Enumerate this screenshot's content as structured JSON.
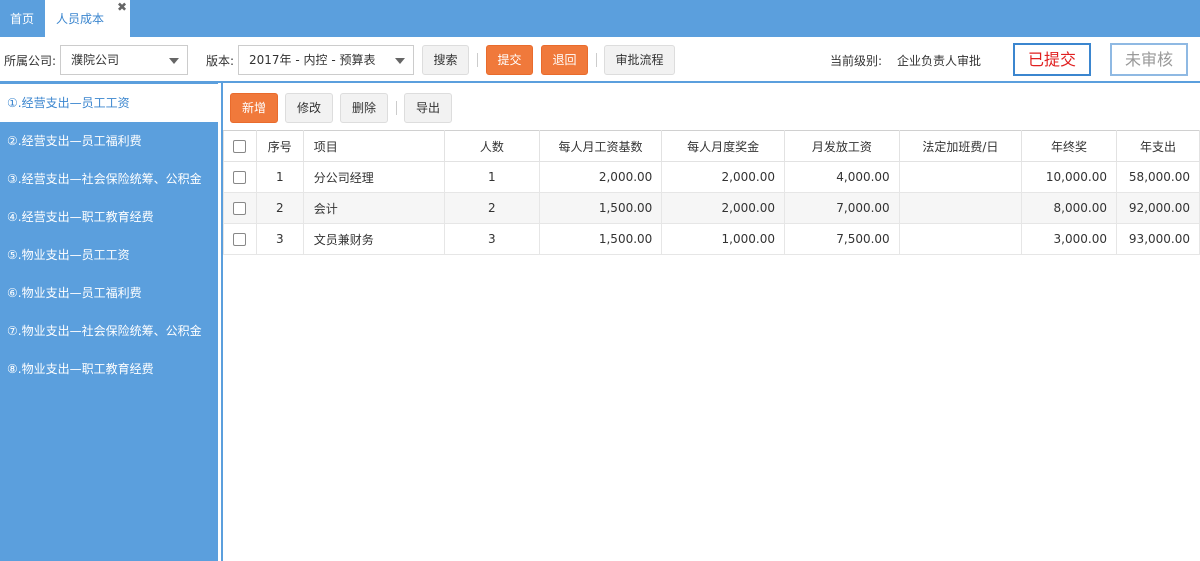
{
  "tabs": {
    "home": "首页",
    "active": "人员成本",
    "close_glyph": "✖"
  },
  "toolbar": {
    "company_label": "所属公司:",
    "company_value": "濮院公司",
    "version_label": "版本:",
    "version_value": "2017年 - 内控 - 预算表",
    "search": "搜索",
    "submit": "提交",
    "return": "退回",
    "approval_flow": "审批流程",
    "level_label": "当前级别:",
    "level_value": "企业负责人审批",
    "status_submitted": "已提交",
    "status_unaudited": "未审核"
  },
  "sidebar": {
    "items": [
      {
        "label": "①.经营支出—员工工资"
      },
      {
        "label": "②.经营支出—员工福利费"
      },
      {
        "label": "③.经营支出—社会保险统筹、公积金"
      },
      {
        "label": "④.经营支出—职工教育经费"
      },
      {
        "label": "⑤.物业支出—员工工资"
      },
      {
        "label": "⑥.物业支出—员工福利费"
      },
      {
        "label": "⑦.物业支出—社会保险统筹、公积金"
      },
      {
        "label": "⑧.物业支出—职工教育经费"
      }
    ]
  },
  "content": {
    "buttons": {
      "add": "新增",
      "edit": "修改",
      "delete": "删除",
      "export": "导出"
    },
    "table": {
      "headers": [
        "序号",
        "项目",
        "人数",
        "每人月工资基数",
        "每人月度奖金",
        "月发放工资",
        "法定加班费/日",
        "年终奖",
        "年支出"
      ],
      "rows": [
        {
          "no": "1",
          "item": "分公司经理",
          "count": "1",
          "base": "2,000.00",
          "bonus": "2,000.00",
          "monthly": "4,000.00",
          "overtime": "",
          "yearend": "10,000.00",
          "annual": "58,000.00"
        },
        {
          "no": "2",
          "item": "会计",
          "count": "2",
          "base": "1,500.00",
          "bonus": "2,000.00",
          "monthly": "7,000.00",
          "overtime": "",
          "yearend": "8,000.00",
          "annual": "92,000.00"
        },
        {
          "no": "3",
          "item": "文员兼财务",
          "count": "3",
          "base": "1,500.00",
          "bonus": "1,000.00",
          "monthly": "7,500.00",
          "overtime": "",
          "yearend": "3,000.00",
          "annual": "93,000.00"
        }
      ]
    }
  }
}
